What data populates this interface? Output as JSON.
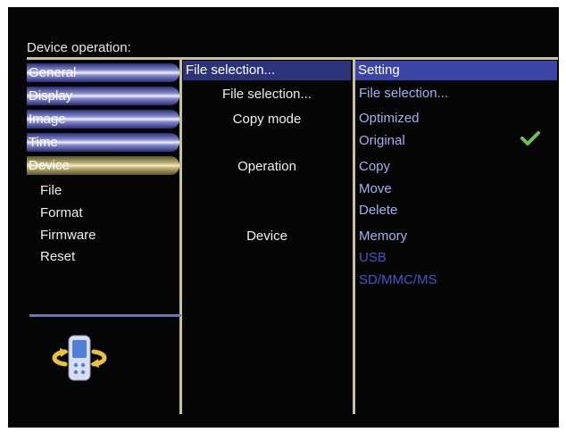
{
  "title": "Device operation:",
  "tabs": [
    {
      "label": "General",
      "active": false
    },
    {
      "label": "Display",
      "active": false
    },
    {
      "label": "Image",
      "active": false
    },
    {
      "label": "Time",
      "active": false
    },
    {
      "label": "Device",
      "active": true
    }
  ],
  "submenu": [
    "File",
    "Format",
    "Firmware",
    "Reset"
  ],
  "middle": {
    "header": "File selection...",
    "labels": [
      "File selection...",
      "Copy mode",
      "Operation",
      "Device"
    ]
  },
  "right": {
    "header": "Setting",
    "options": [
      {
        "label": "File selection...",
        "enabled": true
      },
      {
        "label": "Optimized",
        "enabled": true
      },
      {
        "label": "Original",
        "enabled": true,
        "checked": true
      },
      {
        "label": "Copy",
        "enabled": true
      },
      {
        "label": "Move",
        "enabled": true
      },
      {
        "label": "Delete",
        "enabled": true
      },
      {
        "label": "Memory",
        "enabled": true
      },
      {
        "label": "USB",
        "enabled": false
      },
      {
        "label": "SD/MMC/MS",
        "enabled": false
      }
    ]
  },
  "colors": {
    "background": "#050505",
    "accent_line": "#c8c29a",
    "header_mid": "#2d337a",
    "header_right": "#3d44a8",
    "option_text": "#a9aef4",
    "option_disabled": "#4a53c4",
    "check": "#6fbf5a"
  },
  "icons": {
    "check": "checkmark-icon",
    "device": "device-rotate-icon"
  }
}
